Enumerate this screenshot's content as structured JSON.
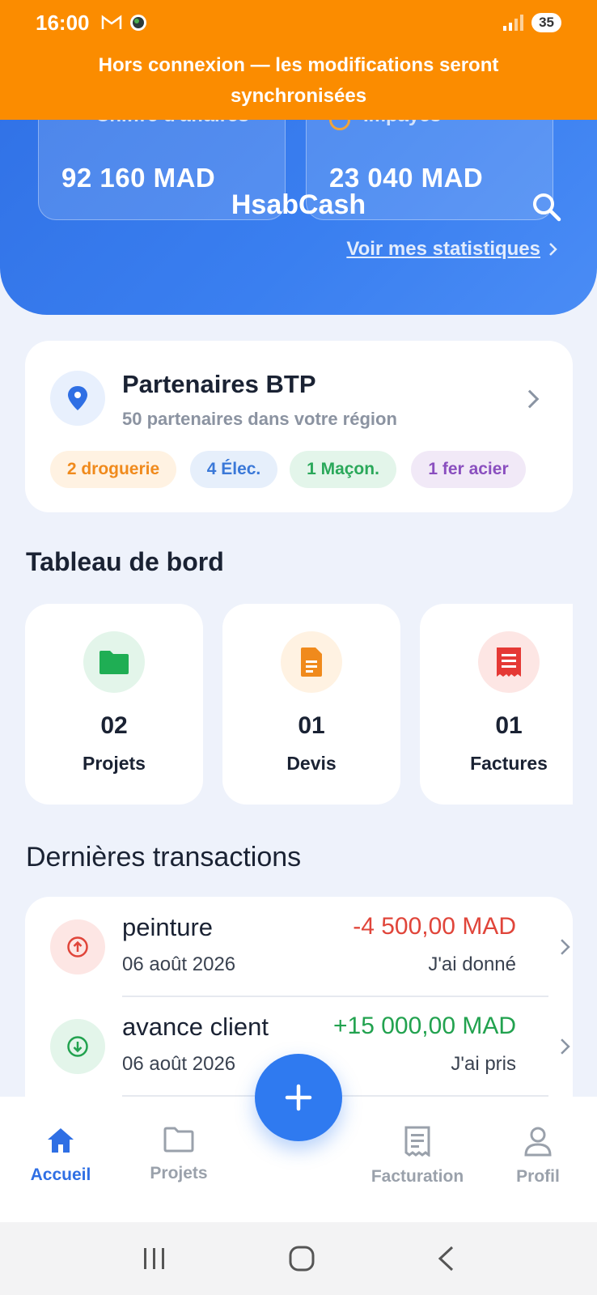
{
  "status_bar": {
    "time": "16:00",
    "battery": "35"
  },
  "banner": {
    "line1": "Hors connexion — les modifications seront",
    "line2": "synchronisées"
  },
  "hero": {
    "stats": [
      {
        "label": "Chiffre d'affaires",
        "value": "92 160 MAD"
      },
      {
        "label": "Impayés",
        "value": "23 040 MAD"
      }
    ],
    "brand": "HsabCash",
    "stats_link": "Voir mes statistiques"
  },
  "partners": {
    "title": "Partenaires BTP",
    "subtitle": "50 partenaires dans votre région",
    "chips": [
      {
        "label": "2 droguerie",
        "color": "#f08a1c",
        "bg": "#fff2e2"
      },
      {
        "label": "4 Élec.",
        "color": "#3a78d8",
        "bg": "#e6effb"
      },
      {
        "label": "1 Maçon.",
        "color": "#2aa85a",
        "bg": "#e3f5ea"
      },
      {
        "label": "1 fer acier",
        "color": "#8a4fbf",
        "bg": "#f1e9f7"
      }
    ]
  },
  "dashboard": {
    "title": "Tableau de bord",
    "tiles": [
      {
        "count": "02",
        "label": "Projets",
        "icon": "folder-icon"
      },
      {
        "count": "01",
        "label": "Devis",
        "icon": "document-icon"
      },
      {
        "count": "01",
        "label": "Factures",
        "icon": "receipt-icon"
      }
    ]
  },
  "transactions": {
    "title": "Dernières transactions",
    "items": [
      {
        "title": "peinture",
        "date": "06 août 2026",
        "amount": "-4 500,00 MAD",
        "kind": "J'ai donné",
        "color": "#e0453a"
      },
      {
        "title": "avance client",
        "date": "06 août 2026",
        "amount": "+15 000,00 MAD",
        "kind": "J'ai pris",
        "color": "#22a24f"
      }
    ]
  },
  "nav": {
    "items": [
      {
        "label": "Accueil"
      },
      {
        "label": "Projets"
      },
      {
        "label": "Facturation"
      },
      {
        "label": "Profil"
      }
    ]
  },
  "colors": {
    "accent": "#2f6fe4",
    "banner": "#fb8c00"
  }
}
